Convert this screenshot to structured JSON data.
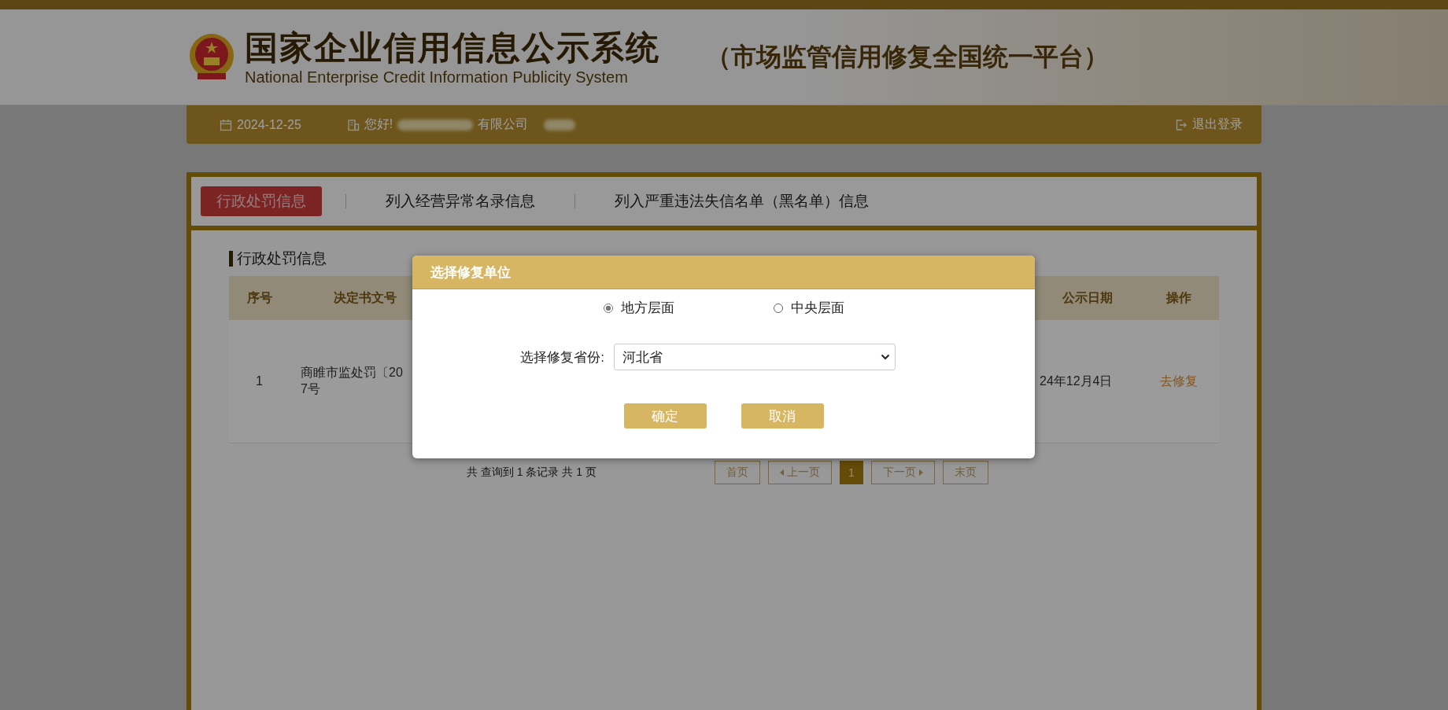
{
  "header": {
    "title": "国家企业信用信息公示系统",
    "subtitle": "National Enterprise Credit Information Publicity System",
    "platform": "（市场监管信用修复全国统一平台）"
  },
  "user_bar": {
    "date": "2024-12-25",
    "greeting": "您好!",
    "company_suffix": "有限公司",
    "logout": "退出登录"
  },
  "tabs": [
    {
      "label": "行政处罚信息",
      "selected": true
    },
    {
      "label": "列入经营异常名录信息",
      "selected": false
    },
    {
      "label": "列入严重违法失信名单（黑名单）信息",
      "selected": false
    }
  ],
  "section_title": "行政处罚信息",
  "table": {
    "columns": [
      "序号",
      "决定书文号",
      "公示日期",
      "操作"
    ],
    "rows": [
      {
        "index": "1",
        "doc_lines": [
          "商睢市监处罚〔20",
          "7号"
        ],
        "date": "24年12月4日",
        "action": "去修复"
      }
    ]
  },
  "pagination": {
    "summary": "共 查询到 1 条记录 共 1 页",
    "buttons": [
      {
        "label": "首页",
        "kind": "first",
        "selected": false
      },
      {
        "label": "上一页",
        "kind": "prev",
        "selected": false
      },
      {
        "label": "1",
        "kind": "page",
        "selected": true
      },
      {
        "label": "下一页",
        "kind": "next",
        "selected": false
      },
      {
        "label": "末页",
        "kind": "last",
        "selected": false
      }
    ]
  },
  "modal": {
    "title": "选择修复单位",
    "radios": [
      {
        "label": "地方层面",
        "selected": true
      },
      {
        "label": "中央层面",
        "selected": false
      }
    ],
    "select_label": "选择修复省份:",
    "select_value": "河北省",
    "buttons": [
      {
        "label": "确定"
      },
      {
        "label": "取消"
      }
    ]
  }
}
